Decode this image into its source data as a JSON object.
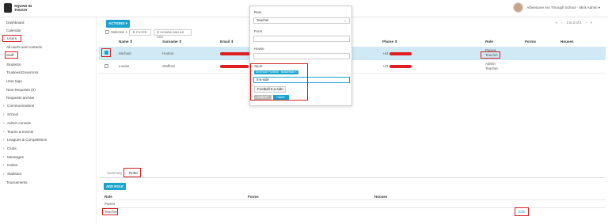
{
  "app": {
    "logo_text": "SQUAD IN TOUCH"
  },
  "user": {
    "label": "Atherstone Ani Through School · Mick Admin ▾"
  },
  "sidebar": {
    "items": [
      {
        "label": "Dashboard",
        "chev": ""
      },
      {
        "label": "Calendar",
        "chev": ""
      },
      {
        "label": "Users",
        "chev": "⌄"
      },
      {
        "label": "All users and contacts",
        "chev": ""
      },
      {
        "label": "Staff",
        "chev": ""
      },
      {
        "label": "Students",
        "chev": ""
      },
      {
        "label": "Trustees/Governors",
        "chev": ""
      },
      {
        "label": "User tags",
        "chev": ""
      },
      {
        "label": "New Requests (0)",
        "chev": ""
      },
      {
        "label": "Requests archive",
        "chev": ""
      },
      {
        "label": "Communications",
        "chev": "›"
      },
      {
        "label": "School",
        "chev": "›"
      },
      {
        "label": "Admin console",
        "chev": "›"
      },
      {
        "label": "Teams & Events",
        "chev": "›"
      },
      {
        "label": "Leagues & Competitions",
        "chev": "›"
      },
      {
        "label": "Clubs",
        "chev": "›"
      },
      {
        "label": "Messages",
        "chev": "›"
      },
      {
        "label": "Invites",
        "chev": "›"
      },
      {
        "label": "Statistics",
        "chev": "›"
      },
      {
        "label": "Tournaments",
        "chev": ""
      }
    ]
  },
  "toolbar": {
    "actions_label": "ACTIONS ▾",
    "selected_label": "Selected: 1",
    "filter_label": "FILTER",
    "download_label": "DOWNLOAD AS CSV",
    "pager": "1 to 2 of 2"
  },
  "table": {
    "headers": [
      "Name ⇕",
      "Surname ⇕",
      "Email ⇕",
      "Phone ⇕",
      "Role",
      "Forms",
      "Houses"
    ],
    "rows": [
      {
        "name": "Michael",
        "surname": "Hooton",
        "phone_prefix": "+44",
        "roles": [
          "Parent",
          "Teacher"
        ]
      },
      {
        "name": "Louise",
        "surname": "Stafford",
        "phone_prefix": "+44",
        "roles": [
          "Admin",
          "Teacher"
        ]
      }
    ]
  },
  "popup": {
    "role_label": "Role",
    "role_value": "Teacher",
    "form_label": "Form",
    "house_label": "House",
    "sport_label": "Sport",
    "tags": [
      "American Football ×",
      "Basketball ×"
    ],
    "sport_input": "5-a-side",
    "suggestion": "Football 5-a-side",
    "cancel_label": "CANCEL",
    "save_label": "SAVE"
  },
  "tabs": [
    {
      "label": "Summary"
    },
    {
      "label": "Roles"
    }
  ],
  "roles_panel": {
    "add_label": "ADD ROLE",
    "headers": [
      "Role",
      "Forms",
      "Houses"
    ],
    "rows": [
      {
        "role": "Parent",
        "action": ""
      },
      {
        "role": "Teacher",
        "action": "Edit"
      }
    ]
  },
  "colors": {
    "accent": "#1aa3cf",
    "highlight": "#d32121",
    "selected_row": "#cfeaf4"
  }
}
